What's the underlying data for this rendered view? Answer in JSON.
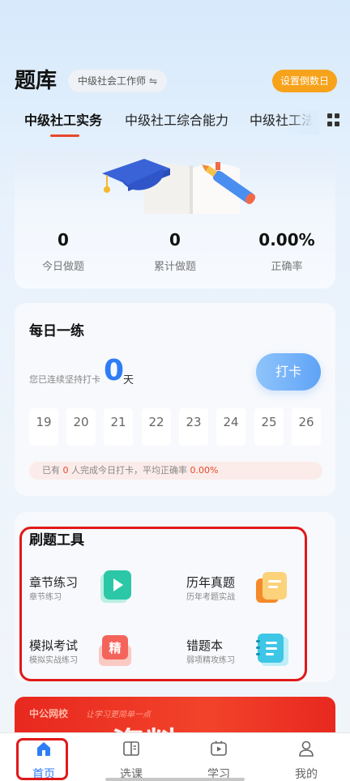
{
  "header": {
    "title": "题库",
    "exam": "中级社会工作师",
    "countdown_btn": "设置倒数日"
  },
  "tabs": [
    {
      "label": "中级社工实务"
    },
    {
      "label": "中级社工综合能力"
    },
    {
      "label": "中级社工法"
    }
  ],
  "stats": [
    {
      "value": "0",
      "label": "今日做题"
    },
    {
      "value": "0",
      "label": "累计做题"
    },
    {
      "value": "0.00%",
      "label": "正确率"
    }
  ],
  "daily": {
    "title": "每日一练",
    "streak_label": "您已连续坚持打卡",
    "streak_value": "0",
    "streak_unit": "天",
    "checkin": "打卡",
    "days": [
      "19",
      "20",
      "21",
      "22",
      "23",
      "24",
      "25",
      "26"
    ],
    "summary_prefix": "已有",
    "summary_count": "0",
    "summary_mid": "人完成今日打卡，平均正确率",
    "summary_rate": "0.00%"
  },
  "tools": {
    "title": "刷题工具",
    "items": [
      {
        "name": "章节练习",
        "sub": "章节练习",
        "icon": "play-icon",
        "color": "#2cc7a7"
      },
      {
        "name": "历年真题",
        "sub": "历年考题实战",
        "icon": "document-icon",
        "color": "#f7a12b"
      },
      {
        "name": "模拟考试",
        "sub": "模拟实战练习",
        "icon": "refine-icon",
        "icon_text": "精",
        "color": "#f4645b"
      },
      {
        "name": "错题本",
        "sub": "弱项精攻练习",
        "icon": "notebook-icon",
        "color": "#3ec6e6"
      }
    ]
  },
  "banner": {
    "logo": "中公网校",
    "slogan": "让学习更简单一点",
    "big_text": "资料"
  },
  "bottom_nav": [
    {
      "label": "首页",
      "icon": "home-icon"
    },
    {
      "label": "选课",
      "icon": "book-icon"
    },
    {
      "label": "学习",
      "icon": "video-icon"
    },
    {
      "label": "我的",
      "icon": "user-icon"
    }
  ],
  "colors": {
    "accent": "#2f7df6",
    "tab_underline": "#e8472b",
    "countdown_bg": "#f7a21b",
    "highlight": "#e01919"
  }
}
